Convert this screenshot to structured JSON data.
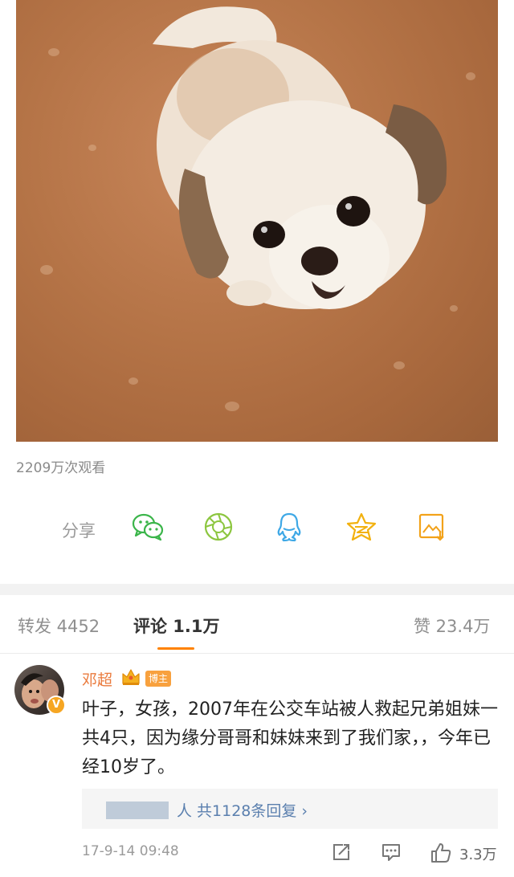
{
  "video": {
    "views": "2209万次观看"
  },
  "share": {
    "label": "分享",
    "icons": [
      "wechat-icon",
      "moments-icon",
      "qq-icon",
      "qzone-icon",
      "save-image-icon"
    ]
  },
  "tabs": {
    "repost": "转发 4452",
    "comments": "评论 1.1万",
    "likes": "赞 23.4万"
  },
  "comment": {
    "username": "邓超",
    "badge": "博主",
    "verified_mark": "V",
    "text": "叶子，女孩，2007年在公交车站被人救起兄弟姐妹一共4只，因为缘分哥哥和妹妹来到了我们家，，今年已经10岁了。",
    "replies": "人 共1128条回复 ›",
    "timestamp": "17-9-14 09:48",
    "like_count": "3.3万"
  },
  "colors": {
    "accent": "#ff8200",
    "username": "#ea7a3c",
    "link": "#5a7fae"
  }
}
